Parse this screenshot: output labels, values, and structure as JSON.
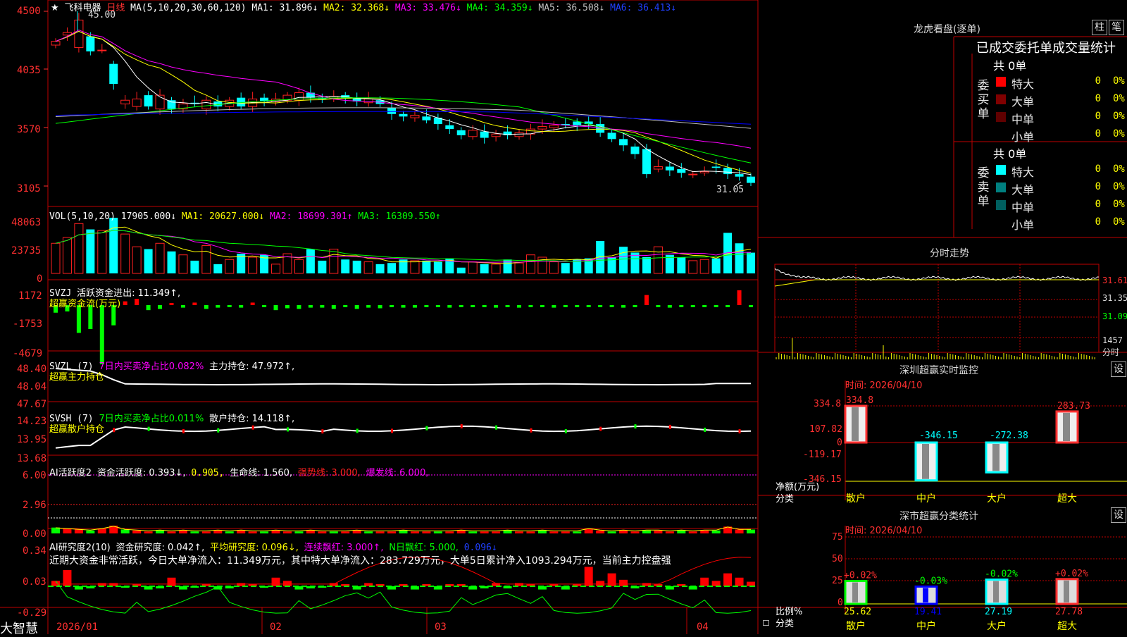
{
  "colors": {
    "up": "#ff2020",
    "down": "#00ffff",
    "border": "#c00000",
    "ma1": "#ffffff",
    "ma2": "#ffff00",
    "ma3": "#ff00ff",
    "ma4": "#00ff00",
    "ma5": "#c0c0c0",
    "ma6": "#0000ff",
    "green_bar": "#00ff00",
    "red_bar": "#ff0000"
  },
  "stock": {
    "star": "★",
    "name": "飞科电器",
    "period": "日线"
  },
  "main_legend": {
    "label": "MA(5,10,20,30,60,120)",
    "ma1": "MA1: 31.896↓",
    "ma2": "MA2: 32.368↓",
    "ma3": "MA3: 33.476↓",
    "ma4": "MA4: 34.359↓",
    "ma5": "MA5: 36.508↓",
    "ma6": "MA6: 36.413↓"
  },
  "main_axis": [
    "4500",
    "4035",
    "3570",
    "3105"
  ],
  "main_annotations": {
    "high": "45.00",
    "low": "31.05"
  },
  "vol_legend": {
    "label": "VOL(5,10,20)",
    "value": "17905.000↓",
    "ma1": "MA1: 20627.000↓",
    "ma2": "MA2: 18699.301↑",
    "ma3": "MA3: 16309.550↑"
  },
  "vol_axis": [
    "48063",
    "23735",
    "0"
  ],
  "svzj": {
    "line1_a": "SVZJ",
    "line1_b": "活跃资金进出: 11.349↑,",
    "line2": "超赢资金流(万元)",
    "axis": [
      "1172",
      "-1753",
      "-4679"
    ]
  },
  "svzl": {
    "prefix": "SVZL (7)",
    "mid": "7日内买卖净占比0.082%",
    "tail": "主力持仓: 47.972↑,",
    "line2": "超赢主力持仓",
    "axis": [
      "48.40",
      "48.04",
      "47.67"
    ]
  },
  "svsh": {
    "prefix": "SVSH (7)",
    "mid": "7日内买卖净占比0.011%",
    "tail": "散户持仓: 14.118↑,",
    "line2": "超赢散户持仓",
    "axis": [
      "14.23",
      "13.95",
      "13.68"
    ]
  },
  "ai_active": {
    "title": "AI活跃度2",
    "a": "资金活跃度: 0.393↓,",
    "b": "0.905,",
    "c": "生命线: 1.560,",
    "d": "强势线: 3.000,",
    "e": "爆发线: 6.000,",
    "axis": [
      "6.00",
      "2.96",
      "0.00"
    ]
  },
  "ai_research": {
    "title": "AI研究度2(10)",
    "a": "资金研究度: 0.042↑,",
    "b": "平均研究度: 0.096↓,",
    "c": "连续飘红: 3.000↑,",
    "d": "N日飘红: 5.000,",
    "e": "0.096↓",
    "comment": "近期大资金非常活跃，今日大单净流入：11.349万元，其中特大单净流入：283.729万元，大单5日累计净入1093.294万元，当前主力控盘强",
    "axis": [
      "0.34",
      "0.03",
      "-0.29"
    ]
  },
  "xaxis": {
    "labels": [
      "2026/01",
      "02",
      "03",
      "04"
    ]
  },
  "brand": "大智慧",
  "right": {
    "lhb_title": "龙虎看盘(逐单)",
    "btn1": "柱",
    "btn2": "笔",
    "header": "已成交委托单成交量统计",
    "buy": {
      "total": "共 0单",
      "side": "委买单",
      "rows": [
        {
          "name": "特大",
          "count": "0",
          "pct": "0%",
          "color": "#ff0000"
        },
        {
          "name": "大单",
          "count": "0",
          "pct": "0%",
          "color": "#800000"
        },
        {
          "name": "中单",
          "count": "0",
          "pct": "0%",
          "color": "#600000"
        },
        {
          "name": "小单",
          "count": "0",
          "pct": "0%",
          "color": "#000000"
        }
      ]
    },
    "sell": {
      "total": "共 0单",
      "side": "委卖单",
      "rows": [
        {
          "name": "特大",
          "count": "0",
          "pct": "0%",
          "color": "#00ffff"
        },
        {
          "name": "大单",
          "count": "0",
          "pct": "0%",
          "color": "#008080"
        },
        {
          "name": "中单",
          "count": "0",
          "pct": "0%",
          "color": "#006060"
        },
        {
          "name": "小单",
          "count": "0",
          "pct": "0%",
          "color": "#000000"
        }
      ]
    },
    "intraday": {
      "title": "分时走势",
      "axis": [
        "31.61",
        "31.35",
        "31.09"
      ],
      "vol_label": "1457",
      "vol_unit": "分时"
    },
    "monitor": {
      "title": "深圳超赢实时监控",
      "btn": "设",
      "time": "时间: 2026/04/10",
      "axis": [
        "334.8",
        "107.82",
        "0",
        "-119.17",
        "-346.15"
      ],
      "ylabel1": "净额(万元)",
      "ylabel2": "分类",
      "bars": [
        {
          "cat": "散户",
          "value": "334.8"
        },
        {
          "cat": "中户",
          "value": "-346.15"
        },
        {
          "cat": "大户",
          "value": "-272.38"
        },
        {
          "cat": "超大",
          "value": "283.73"
        }
      ]
    },
    "classify": {
      "title": "深市超赢分类统计",
      "btn": "设",
      "time": "时间: 2026/04/10",
      "axis": [
        "75",
        "50",
        "25",
        "0"
      ],
      "ylabel1": "比例%",
      "ylabel2": "分类",
      "bars": [
        {
          "cat": "散户",
          "pct": "25.62",
          "chg": "+0.02%"
        },
        {
          "cat": "中户",
          "pct": "19.41",
          "chg": "-0.03%"
        },
        {
          "cat": "大户",
          "pct": "27.19",
          "chg": "-0.02%"
        },
        {
          "cat": "超大",
          "pct": "27.78",
          "chg": "+0.02%"
        }
      ]
    }
  }
}
